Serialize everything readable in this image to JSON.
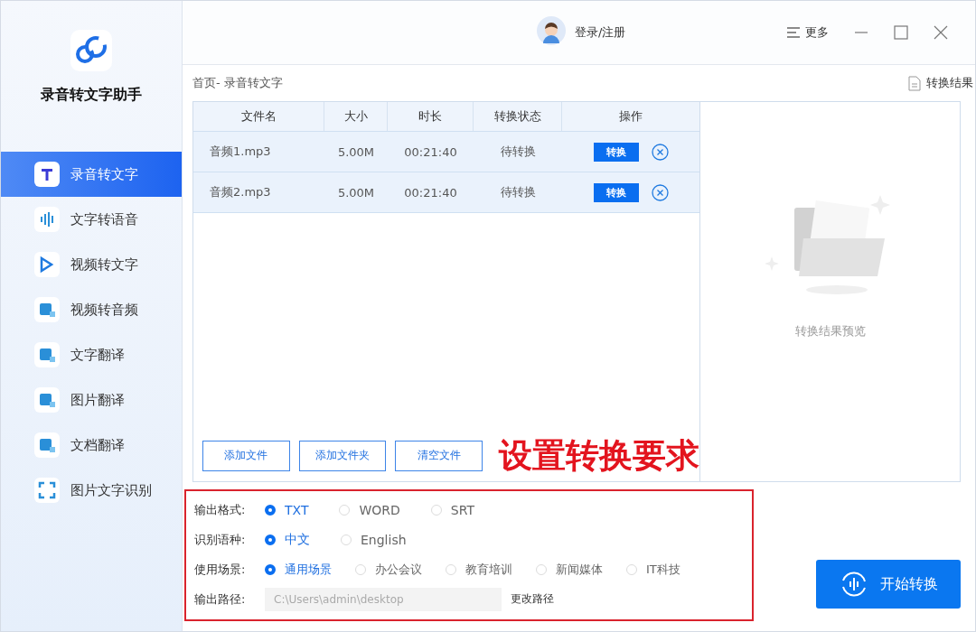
{
  "app": {
    "title": "录音转文字助手"
  },
  "sidebar": {
    "items": [
      {
        "label": "录音转文字",
        "selected": true
      },
      {
        "label": "文字转语音",
        "selected": false
      },
      {
        "label": "视频转文字",
        "selected": false
      },
      {
        "label": "视频转音频",
        "selected": false
      },
      {
        "label": "文字翻译",
        "selected": false
      },
      {
        "label": "图片翻译",
        "selected": false
      },
      {
        "label": "文档翻译",
        "selected": false
      },
      {
        "label": "图片文字识别",
        "selected": false
      }
    ]
  },
  "topbar": {
    "login": "登录/注册",
    "more": "更多"
  },
  "breadcrumb": "首页- 录音转文字",
  "results_link": "转换结果",
  "table": {
    "columns": [
      "文件名",
      "大小",
      "时长",
      "转换状态",
      "操作"
    ],
    "rows": [
      {
        "name": "音频1.mp3",
        "size": "5.00M",
        "duration": "00:21:40",
        "status": "待转换",
        "action": "转换"
      },
      {
        "name": "音频2.mp3",
        "size": "5.00M",
        "duration": "00:21:40",
        "status": "待转换",
        "action": "转换"
      }
    ]
  },
  "file_buttons": [
    "添加文件",
    "添加文件夹",
    "清空文件"
  ],
  "preview": {
    "caption": "转换结果预览"
  },
  "annotation": "设置转换要求",
  "settings": [
    {
      "label": "输出格式:",
      "kind": "radio",
      "options": [
        {
          "label": "TXT",
          "selected": true
        },
        {
          "label": "WORD",
          "selected": false
        },
        {
          "label": "SRT",
          "selected": false
        }
      ]
    },
    {
      "label": "识别语种:",
      "kind": "radio",
      "options": [
        {
          "label": "中文",
          "selected": true
        },
        {
          "label": "English",
          "selected": false
        }
      ]
    },
    {
      "label": "使用场景:",
      "kind": "radio",
      "options": [
        {
          "label": "通用场景",
          "selected": true
        },
        {
          "label": "办公会议",
          "selected": false
        },
        {
          "label": "教育培训",
          "selected": false
        },
        {
          "label": "新闻媒体",
          "selected": false
        },
        {
          "label": "IT科技",
          "selected": false
        }
      ]
    },
    {
      "label": "输出路径:",
      "kind": "path",
      "value": "C:\\Users\\admin\\desktop",
      "action": "更改路径"
    }
  ],
  "start_button": "开始转换"
}
